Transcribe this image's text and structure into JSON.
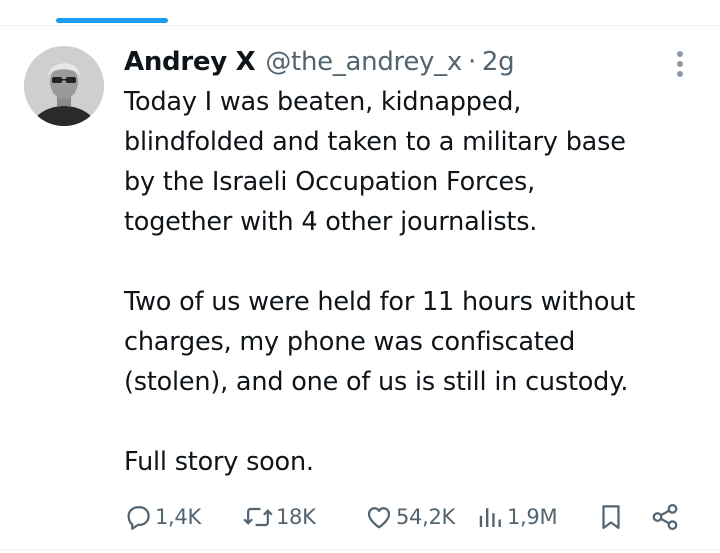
{
  "tweet": {
    "display_name": "Andrey X",
    "handle": "@the_andrey_x",
    "separator": "·",
    "time": "2g",
    "paragraphs": [
      "Today I was beaten, kidnapped,\nblindfolded and taken to a military base\nby the Israeli Occupation Forces,\ntogether with 4 other journalists.",
      "Two of us were held for 11 hours without\ncharges, my phone was confiscated\n(stolen), and one of us is still in custody.",
      "Full story soon."
    ]
  },
  "actions": {
    "replies": "1,4K",
    "reposts": "18K",
    "likes": "54,2K",
    "views": "1,9M"
  },
  "colors": {
    "accent": "#1d9bf0",
    "text_primary": "#0f1419",
    "text_secondary": "#536471",
    "divider": "#eff3f4"
  },
  "icons": {
    "more": "more-vertical-icon",
    "reply": "reply-icon",
    "repost": "repost-icon",
    "like": "heart-icon",
    "views": "views-chart-icon",
    "bookmark": "bookmark-icon",
    "share": "share-icon"
  }
}
